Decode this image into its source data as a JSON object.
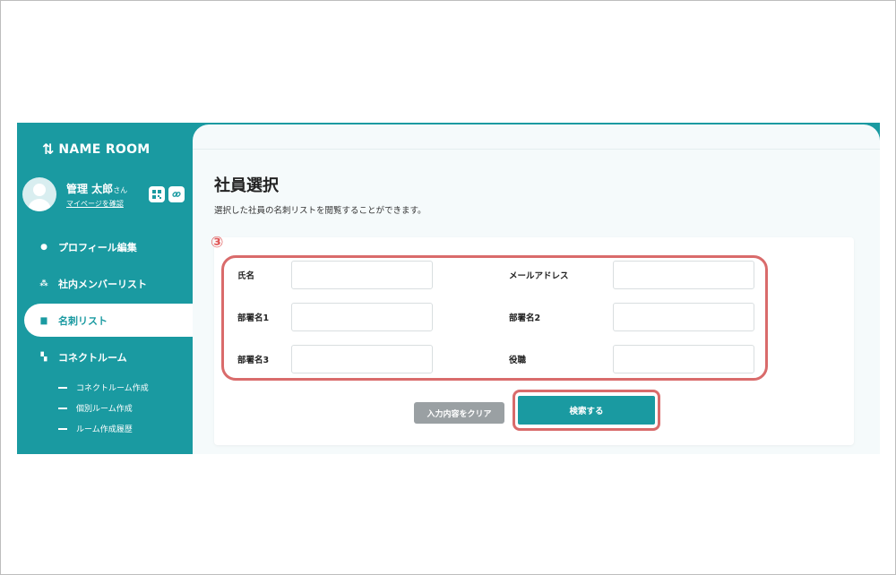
{
  "app": {
    "logo_icon": "⇅",
    "logo_text": "NAME ROOM"
  },
  "user": {
    "name": "管理 太郎",
    "honorific": "さん",
    "mypage_link": "マイページを確認",
    "qr_icon": "qr-code-icon",
    "link_icon": "link-icon"
  },
  "sidebar": {
    "items": [
      {
        "label": "プロフィール編集",
        "icon": "person-icon",
        "glyph": "●"
      },
      {
        "label": "社内メンバーリスト",
        "icon": "group-icon",
        "glyph": "⁂"
      },
      {
        "label": "名刺リスト",
        "icon": "card-icon",
        "glyph": "▆"
      },
      {
        "label": "コネクトルーム",
        "icon": "room-icon",
        "glyph": "▚"
      }
    ],
    "subitems": [
      {
        "label": "コネクトルーム作成"
      },
      {
        "label": "個別ルーム作成"
      },
      {
        "label": "ルーム作成履歴"
      }
    ]
  },
  "main": {
    "title": "社員選択",
    "description": "選択した社員の名刺リストを閲覧することができます。",
    "step_number": "③",
    "form": {
      "name_label": "氏名",
      "email_label": "メールアドレス",
      "dept1_label": "部署名1",
      "dept2_label": "部署名2",
      "dept3_label": "部署名3",
      "position_label": "役職",
      "name_value": "",
      "email_value": "",
      "dept1_value": "",
      "dept2_value": "",
      "dept3_value": "",
      "position_value": ""
    },
    "clear_label": "入力内容をクリア",
    "search_label": "検索する"
  },
  "colors": {
    "brand": "#1a9aa1",
    "highlight": "#d96b6b"
  }
}
